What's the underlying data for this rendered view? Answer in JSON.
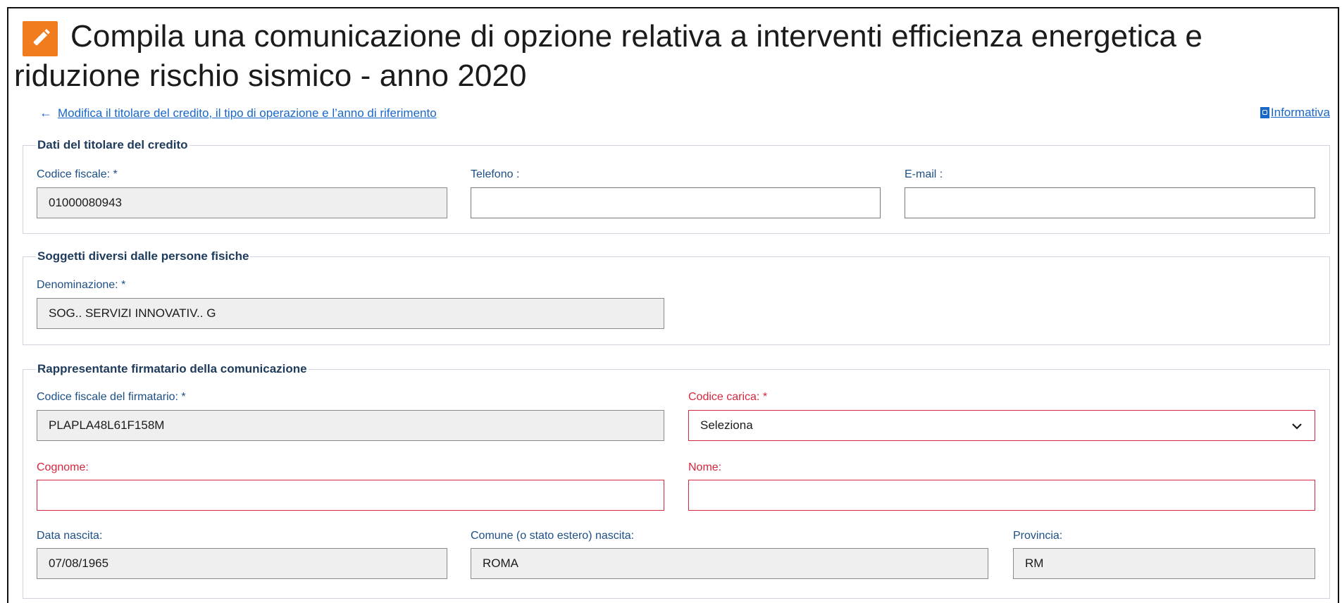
{
  "page": {
    "title": "Compila una comunicazione di opzione relativa a interventi efficienza energetica e riduzione rischio sismico - anno 2020",
    "title_icon": "pencil-edit-icon",
    "back_link": "Modifica il titolare del credito, il tipo di operazione e l’anno di riferimento",
    "back_icon": "arrow-left-icon",
    "info_link": "Informativa",
    "info_icon": "pdf-icon"
  },
  "colors": {
    "accent": "#f07c1e",
    "link": "#1967c8",
    "label": "#1d4f86",
    "error": "#d5273d",
    "readonly_bg": "#efefef"
  },
  "titolare": {
    "legend": "Dati del titolare del credito",
    "codice_fiscale_label": "Codice fiscale: *",
    "codice_fiscale_value": "01000080943",
    "telefono_label": "Telefono :",
    "telefono_value": "",
    "email_label": "E-mail :",
    "email_value": ""
  },
  "soggetti": {
    "legend": "Soggetti diversi dalle persone fisiche",
    "denominazione_label": "Denominazione: *",
    "denominazione_value": "SOG.. SERVIZI INNOVATIV.. G"
  },
  "rappresentante": {
    "legend": "Rappresentante firmatario della comunicazione",
    "cf_firmatario_label": "Codice fiscale del firmatario: *",
    "cf_firmatario_value": "PLAPLA48L61F158M",
    "codice_carica_label": "Codice carica: *",
    "codice_carica_value": "Seleziona",
    "cognome_label": "Cognome:",
    "cognome_value": "",
    "nome_label": "Nome:",
    "nome_value": "",
    "data_nascita_label": "Data nascita:",
    "data_nascita_value": "07/08/1965",
    "comune_label": "Comune (o stato estero) nascita:",
    "comune_value": "ROMA",
    "provincia_label": "Provincia:",
    "provincia_value": "RM"
  }
}
